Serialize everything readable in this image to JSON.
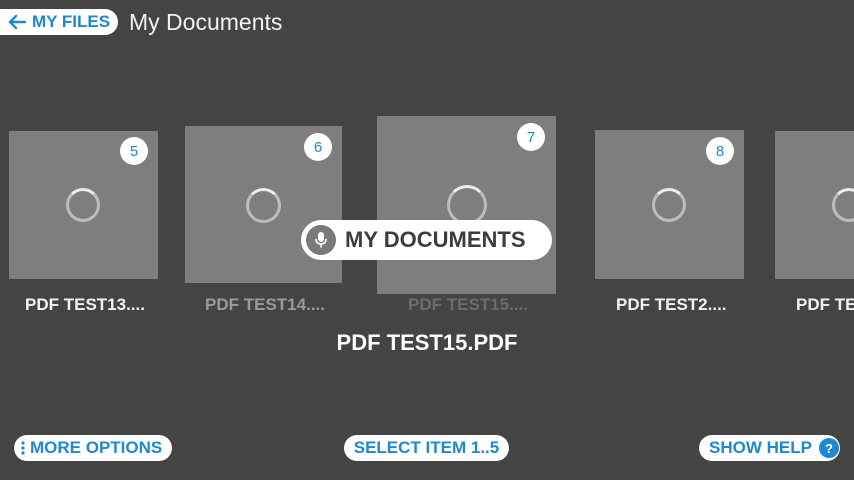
{
  "header": {
    "back_label": "MY FILES",
    "title": "My Documents"
  },
  "carousel": {
    "items": [
      {
        "badge": "5",
        "label": "PDF TEST13...."
      },
      {
        "badge": "6",
        "label": "PDF TEST14...."
      },
      {
        "badge": "7",
        "label": "PDF TEST15...."
      },
      {
        "badge": "8",
        "label": "PDF TEST2...."
      },
      {
        "label": "PDF TE"
      }
    ],
    "selected_name": "PDF TEST15.PDF"
  },
  "voice_overlay": {
    "label": "MY DOCUMENTS",
    "icon": "mic-icon"
  },
  "bottom_bar": {
    "more_options": "MORE OPTIONS",
    "select_items": "SELECT ITEM 1..5",
    "show_help": "SHOW HELP",
    "help_icon": "?"
  },
  "colors": {
    "background": "#444444",
    "accent": "#1e88d2",
    "tile": "#7e7e7e"
  }
}
